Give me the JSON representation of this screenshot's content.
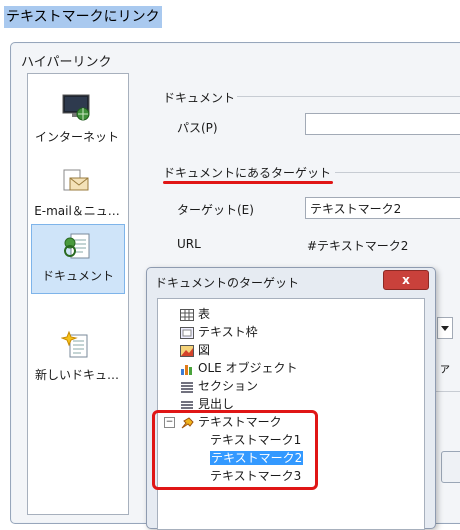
{
  "selected_text": "テキストマークにリンク",
  "dialog": {
    "title": "ハイパーリンク",
    "nav": [
      {
        "label": "インターネット",
        "icon": "internet-icon",
        "selected": false
      },
      {
        "label": "E-mail＆ニュ…",
        "icon": "email-icon",
        "selected": false
      },
      {
        "label": "ドキュメント",
        "icon": "document-icon",
        "selected": true
      },
      {
        "label": "新しいドキュ…",
        "icon": "new-document-icon",
        "selected": false
      }
    ],
    "document_section": "ドキュメント",
    "path_label": "パス(P)",
    "path_value": "",
    "target_section": "ドキュメントにあるターゲット",
    "target_label": "ターゲット(E)",
    "target_value": "テキストマーク2",
    "url_label": "URL",
    "url_value": "#テキストマーク2",
    "partial_text": "ァ"
  },
  "popup": {
    "title": "ドキュメントのターゲット",
    "close_label": "x",
    "tree": [
      {
        "label": "表",
        "icon": "table-icon"
      },
      {
        "label": "テキスト枠",
        "icon": "text-frame-icon"
      },
      {
        "label": "図",
        "icon": "image-icon"
      },
      {
        "label": "OLE オブジェクト",
        "icon": "ole-object-icon"
      },
      {
        "label": "セクション",
        "icon": "section-icon"
      },
      {
        "label": "見出し",
        "icon": "heading-icon"
      },
      {
        "label": "テキストマーク",
        "icon": "bookmark-icon",
        "expanded": true,
        "children": [
          {
            "label": "テキストマーク1",
            "selected": false
          },
          {
            "label": "テキストマーク2",
            "selected": true
          },
          {
            "label": "テキストマーク3",
            "selected": false
          }
        ]
      }
    ]
  },
  "colors": {
    "highlight": "#e01616",
    "selection": "#3399ff",
    "nav_selected": "#cfe4f9"
  }
}
